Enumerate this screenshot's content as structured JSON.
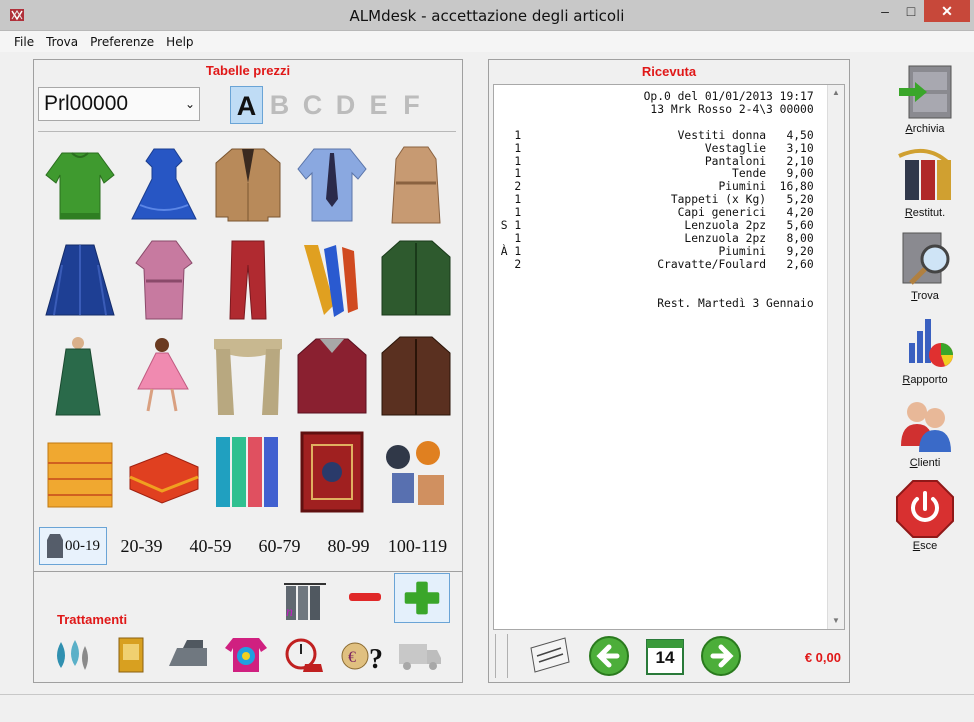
{
  "window": {
    "title": "ALMdesk - accettazione degli articoli"
  },
  "menu": [
    "File",
    "Trova",
    "Preferenze",
    "Help"
  ],
  "left": {
    "title": "Tabelle prezzi",
    "price_list": "Prl00000",
    "letters": [
      "A",
      "B",
      "C",
      "D",
      "E",
      "F"
    ],
    "active_letter": "A",
    "items": [
      "sweater-icon",
      "dress-icon",
      "jacket-icon",
      "shirt-tie-icon",
      "coat-icon",
      "skirt-icon",
      "robe-icon",
      "trousers-icon",
      "ties-icon",
      "parka-icon",
      "raincoat-icon",
      "girl-dress-icon",
      "curtain-icon",
      "down-jacket-icon",
      "leather-coat-icon",
      "bedspread-icon",
      "blanket-icon",
      "towels-icon",
      "carpet-icon",
      "misc-items-icon"
    ],
    "ranges": [
      "00-19",
      "20-39",
      "40-59",
      "60-79",
      "80-99",
      "100-119"
    ],
    "active_range": "00-19",
    "treatments_title": "Trattamenti",
    "treatments": [
      "drops-icon",
      "book-icon",
      "iron-icon",
      "tie-dye-icon",
      "stopwatch-icon",
      "currency-question-icon",
      "delivery-truck-icon"
    ]
  },
  "receipt": {
    "title": "Ricevuta",
    "header": [
      "Op.0 del 01/01/2013 19:17",
      "13 Mrk Rosso 2-4\\3 00000"
    ],
    "lines": [
      {
        "flag": " ",
        "qty": "1",
        "desc": "Vestiti donna",
        "price": "4,50"
      },
      {
        "flag": " ",
        "qty": "1",
        "desc": "Vestaglie",
        "price": "3,10"
      },
      {
        "flag": " ",
        "qty": "1",
        "desc": "Pantaloni",
        "price": "2,10"
      },
      {
        "flag": " ",
        "qty": "1",
        "desc": "Tende",
        "price": "9,00"
      },
      {
        "flag": " ",
        "qty": "2",
        "desc": "Piumini",
        "price": "16,80"
      },
      {
        "flag": " ",
        "qty": "1",
        "desc": "Tappeti (x Kg)",
        "price": "5,20"
      },
      {
        "flag": " ",
        "qty": "1",
        "desc": "Capi generici",
        "price": "4,20"
      },
      {
        "flag": "S",
        "qty": "1",
        "desc": "Lenzuola 2pz",
        "price": "5,60"
      },
      {
        "flag": " ",
        "qty": "1",
        "desc": "Lenzuola 2pz",
        "price": "8,00"
      },
      {
        "flag": "À",
        "qty": "1",
        "desc": "Piumini",
        "price": "9,20"
      },
      {
        "flag": " ",
        "qty": "2",
        "desc": "Cravatte/Foulard",
        "price": "2,60"
      }
    ],
    "footer": "Rest. Martedì 3 Gennaio",
    "calendar_day": "14",
    "total": "€ 0,00"
  },
  "sidebar": [
    {
      "label": "Archivia",
      "underline": "A",
      "rest": "rchivia",
      "icon": "archive-cabinet-icon"
    },
    {
      "label": "Restitut.",
      "underline": "R",
      "rest": "estitut.",
      "icon": "return-clothes-icon"
    },
    {
      "label": "Trova",
      "underline": "T",
      "rest": "rova",
      "icon": "find-magnifier-icon"
    },
    {
      "label": "Rapporto",
      "underline": "R",
      "rest": "apporto",
      "icon": "report-chart-icon"
    },
    {
      "label": "Clienti",
      "underline": "C",
      "rest": "lienti",
      "icon": "customers-icon"
    },
    {
      "label": "Esce",
      "underline": "E",
      "rest": "sce",
      "icon": "power-exit-icon"
    }
  ],
  "colors": {
    "accent_red": "#e01818",
    "selection_blue": "#bfdcf5",
    "plus_green": "#3aa62a"
  }
}
